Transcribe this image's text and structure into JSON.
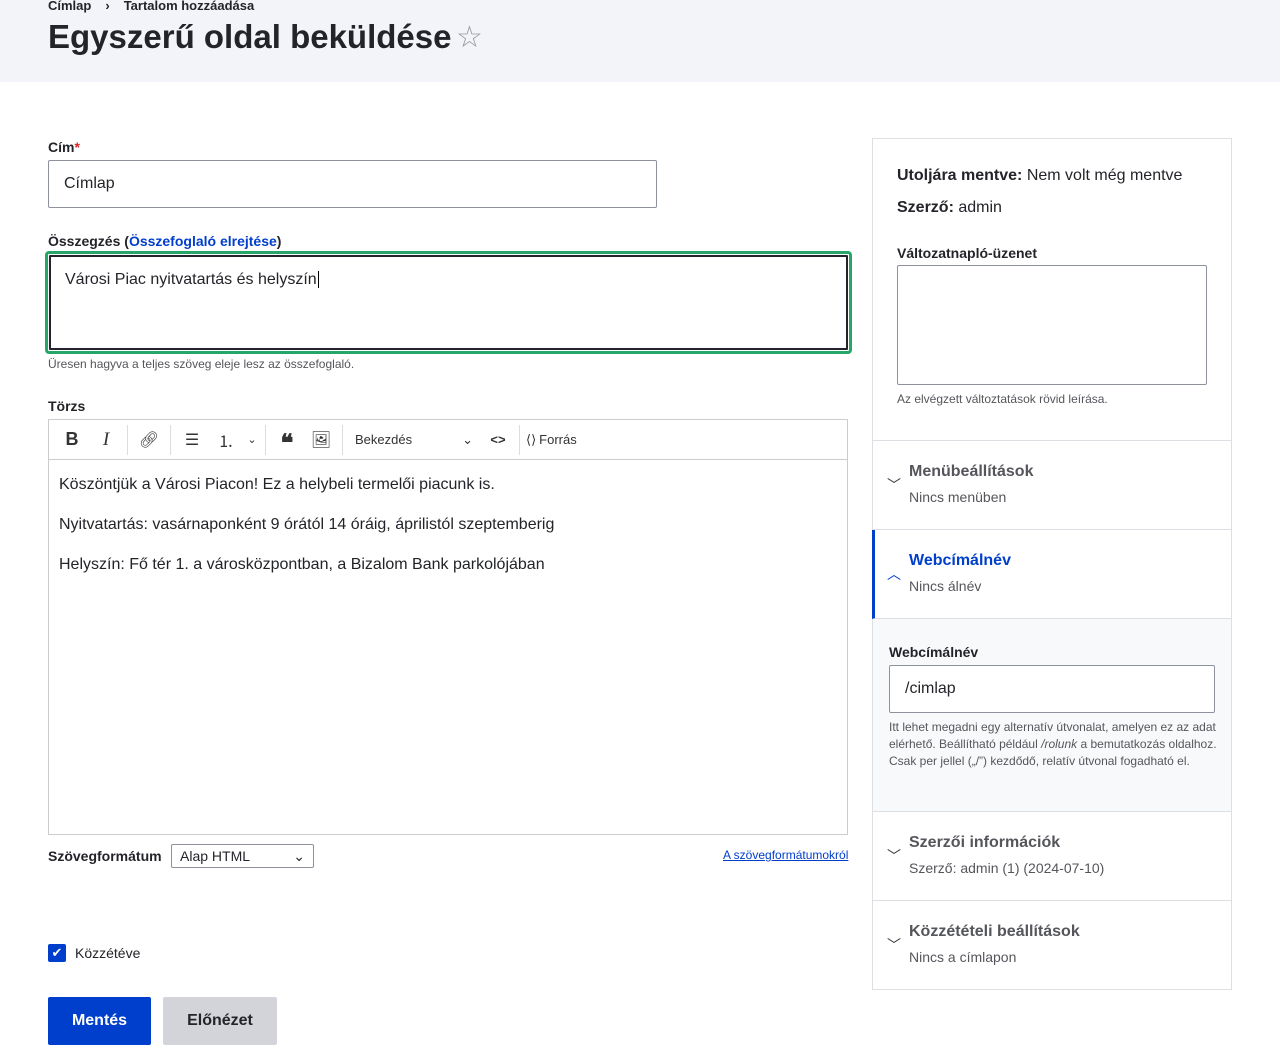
{
  "breadcrumb": [
    "Címlap",
    "Tartalom hozzáadása"
  ],
  "page_title": "Egyszerű oldal beküldése",
  "title_field": {
    "label": "Cím",
    "required": "*",
    "value": "Címlap"
  },
  "summary": {
    "label": "Összegzés (",
    "link": "Összefoglaló elrejtése",
    "label_end": ")",
    "value": "Városi Piac nyitvatartás és helyszín",
    "description": "Üresen hagyva a teljes szöveg eleje lesz az összefoglaló."
  },
  "body": {
    "label": "Törzs",
    "toolbar": {
      "heading": "Bekezdés",
      "source": "Forrás"
    },
    "paragraphs": [
      "Köszöntjük a Városi Piacon! Ez a helybeli termelői piacunk is.",
      "Nyitvatartás: vasárnaponként 9 órától 14 óráig, áprilistól szeptemberig",
      "Helyszín: Fő tér 1. a városközpontban, a Bizalom Bank parkolójában"
    ]
  },
  "format": {
    "label": "Szövegformátum",
    "value": "Alap HTML",
    "link": "A szövegformátumokról"
  },
  "published": {
    "label": "Közzétéve",
    "checked": true
  },
  "buttons": {
    "save": "Mentés",
    "preview": "Előnézet"
  },
  "sidebar": {
    "last_saved_label": "Utoljára mentve:",
    "last_saved": "Nem volt még mentve",
    "author_label": "Szerző:",
    "author": "admin",
    "revision_label": "Változatnapló-üzenet",
    "revision_desc": "Az elvégzett változtatások rövid leírása.",
    "sections": [
      {
        "title": "Menübeállítások",
        "summary": "Nincs menüben"
      },
      {
        "title": "Webcímálnév",
        "summary": "Nincs álnév"
      },
      {
        "title": "Szerzői információk",
        "summary": "Szerző: admin (1) (2024-07-10)"
      },
      {
        "title": "Közzétételi beállítások",
        "summary": "Nincs a címlapon"
      }
    ],
    "alias": {
      "label": "Webcímálnév",
      "value": "/cimlap",
      "desc1": "Itt lehet megadni egy alternatív útvonalat, amelyen ez az adat elérhető. Beállítható például ",
      "desc_em": "/rolunk",
      "desc2": " a bemutatkozás oldalhoz. Csak per jellel („/”) kezdődő, relatív útvonal fogadható el."
    }
  },
  "colors": {
    "primary": "#003ecc",
    "focus": "#26a769"
  }
}
